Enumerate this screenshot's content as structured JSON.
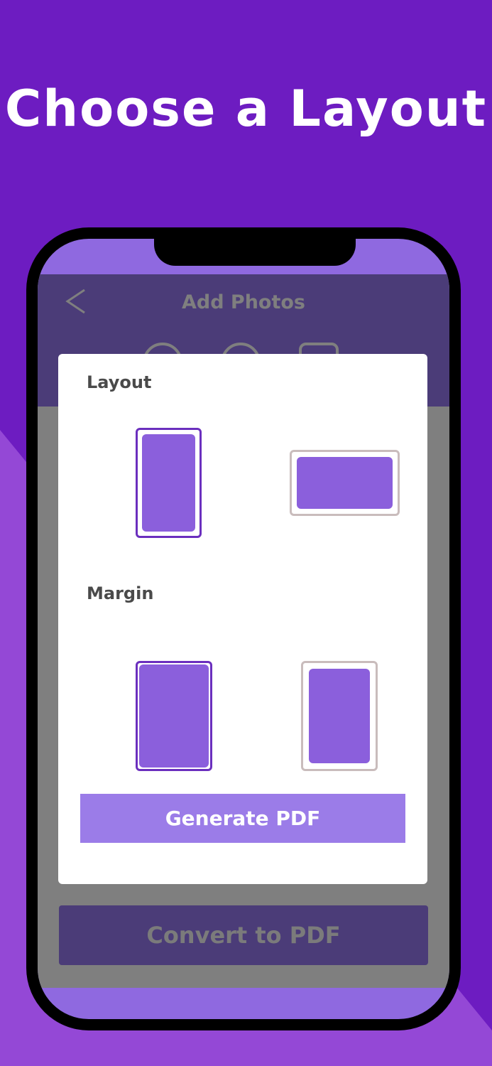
{
  "headline": "Choose a Layout",
  "app": {
    "title": "Add Photos",
    "convert_label": "Convert to PDF"
  },
  "modal": {
    "layout_label": "Layout",
    "margin_label": "Margin",
    "generate_label": "Generate PDF",
    "layout_options": [
      {
        "id": "portrait",
        "selected": true
      },
      {
        "id": "landscape",
        "selected": false
      }
    ],
    "margin_options": [
      {
        "id": "no-margin",
        "selected": true
      },
      {
        "id": "with-margin",
        "selected": false
      }
    ]
  },
  "colors": {
    "background": "#6d1cc1",
    "accent": "#8b5fdc",
    "selected_border": "#6b2fbe",
    "unselected_border": "#c9bcbc",
    "button": "#9b7ce8",
    "header": "#4b3c78"
  },
  "icons": [
    "back-chevron-icon",
    "image-icon",
    "camera-icon",
    "scan-icon"
  ]
}
